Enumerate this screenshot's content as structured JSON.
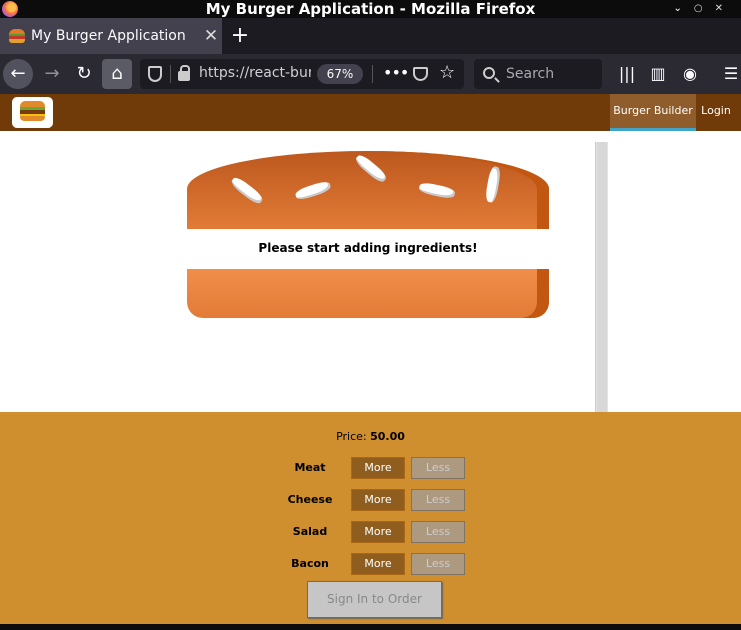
{
  "window": {
    "title": "My Burger Application - Mozilla Firefox"
  },
  "tab": {
    "title": "My Burger Application",
    "close_glyph": "✕",
    "new_tab_glyph": "+"
  },
  "toolbar": {
    "url": "https://react-bur",
    "zoom": "67%",
    "search_placeholder": "Search",
    "icons": [
      "back-icon",
      "forward-icon",
      "reload-icon",
      "home-icon",
      "shield-icon",
      "lock-icon",
      "more-icon",
      "pocket-icon",
      "bookmark-star-icon",
      "search-icon",
      "library-icon",
      "sidebar-icon",
      "account-icon",
      "menu-icon"
    ]
  },
  "app": {
    "nav": {
      "burger_builder": "Burger Builder",
      "login": "Login"
    },
    "burger": {
      "message": "Please start adding ingredients!"
    },
    "price": {
      "label": "Price: ",
      "value": "50.00"
    },
    "controls": [
      {
        "label": "Meat",
        "more": "More",
        "less": "Less"
      },
      {
        "label": "Cheese",
        "more": "More",
        "less": "Less"
      },
      {
        "label": "Salad",
        "more": "More",
        "less": "Less"
      },
      {
        "label": "Bacon",
        "more": "More",
        "less": "Less"
      }
    ],
    "order_button": "Sign In to Order",
    "colors": {
      "appbar": "#703b09",
      "controls_bg": "#cf8f2e",
      "more_button": "#8f5e1e",
      "bread": "#e27b36"
    }
  }
}
